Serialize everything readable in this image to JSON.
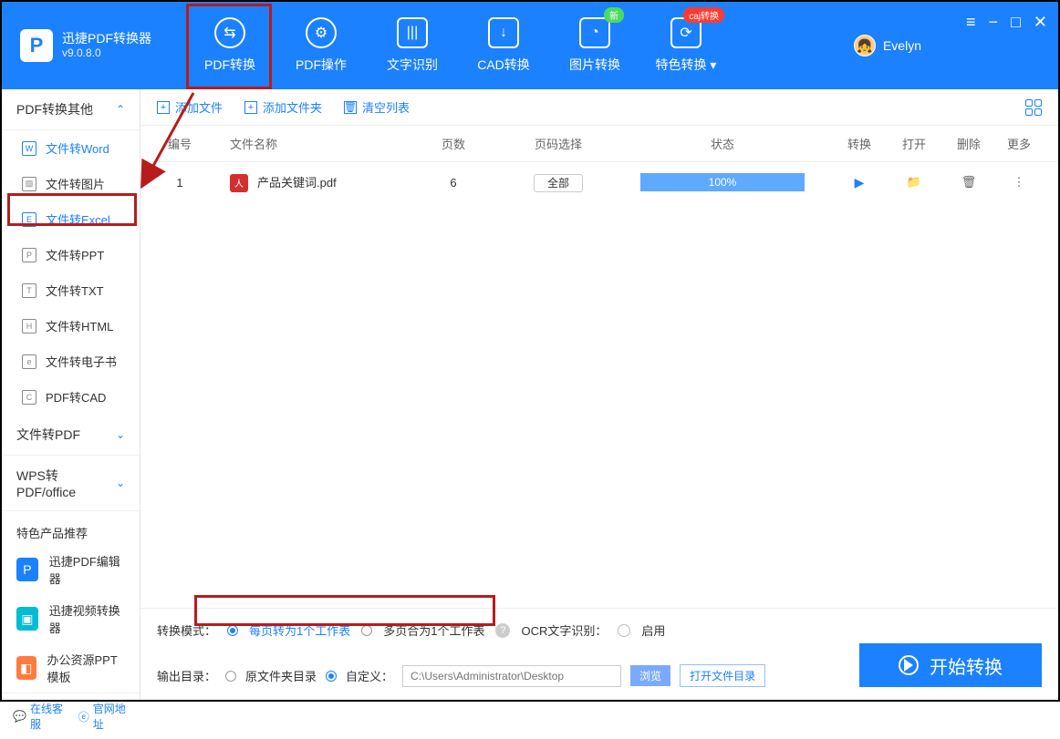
{
  "app": {
    "name": "迅捷PDF转换器",
    "version": "v9.0.8.0"
  },
  "tabs": [
    {
      "label": "PDF转换",
      "badge": null
    },
    {
      "label": "PDF操作",
      "badge": null
    },
    {
      "label": "文字识别",
      "badge": null
    },
    {
      "label": "CAD转换",
      "badge": null
    },
    {
      "label": "图片转换",
      "badge": null
    },
    {
      "label": "特色转换",
      "badge": null
    }
  ],
  "badges": {
    "new": "新",
    "caj": "caj转换"
  },
  "user": {
    "name": "Evelyn"
  },
  "sidebar": {
    "group1": "PDF转换其他",
    "items": [
      "文件转Word",
      "文件转图片",
      "文件转Excel",
      "文件转PPT",
      "文件转TXT",
      "文件转HTML",
      "文件转电子书",
      "PDF转CAD"
    ],
    "group2": "文件转PDF",
    "group3": "WPS转PDF/office"
  },
  "promo": {
    "title": "特色产品推荐",
    "items": [
      "迅捷PDF编辑器",
      "迅捷视频转换器",
      "办公资源PPT模板"
    ]
  },
  "footer": {
    "support": "在线客服",
    "site": "官网地址"
  },
  "toolbar": {
    "add_file": "添加文件",
    "add_folder": "添加文件夹",
    "clear": "清空列表"
  },
  "table": {
    "headers": {
      "num": "编号",
      "name": "文件名称",
      "pages": "页数",
      "sel": "页码选择",
      "status": "状态",
      "conv": "转换",
      "open": "打开",
      "del": "删除",
      "more": "更多"
    },
    "rows": [
      {
        "num": "1",
        "name": "产品关键词.pdf",
        "pages": "6",
        "sel": "全部",
        "status": "100%"
      }
    ]
  },
  "settings": {
    "mode_label": "转换模式：",
    "opt1": "每页转为1个工作表",
    "opt2": "多页合为1个工作表",
    "ocr_label": "OCR文字识别：",
    "enable": "启用"
  },
  "output": {
    "label": "输出目录：",
    "opt_orig": "原文件夹目录",
    "opt_custom": "自定义：",
    "path": "C:\\Users\\Administrator\\Desktop",
    "browse": "浏览",
    "open_folder": "打开文件目录"
  },
  "start": "开始转换"
}
